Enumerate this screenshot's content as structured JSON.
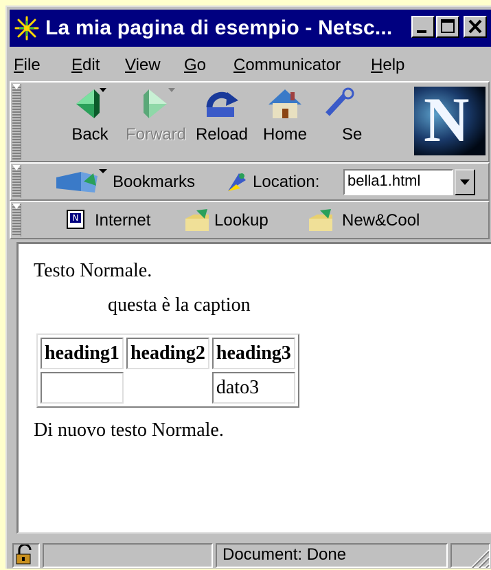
{
  "window": {
    "title": "La mia pagina di esempio - Netsc..."
  },
  "menu": [
    {
      "label_u": "F",
      "label_rest": "ile"
    },
    {
      "label_u": "E",
      "label_rest": "dit"
    },
    {
      "label_u": "V",
      "label_rest": "iew"
    },
    {
      "label_u": "G",
      "label_rest": "o"
    },
    {
      "label_u": "C",
      "label_rest": "ommunicator"
    },
    {
      "label_u": "H",
      "label_rest": "elp"
    }
  ],
  "nav_toolbar": {
    "back": "Back",
    "forward": "Forward",
    "reload": "Reload",
    "home": "Home",
    "search": "Sea"
  },
  "location_toolbar": {
    "bookmarks": "Bookmarks",
    "location_label": "Location:",
    "location_value": "bella1.html"
  },
  "personal_toolbar": {
    "items": [
      "Internet",
      "Lookup",
      "New&Cool"
    ]
  },
  "page": {
    "text1": "Testo Normale.",
    "caption": "questa è la caption",
    "headings": [
      "heading1",
      "heading2",
      "heading3"
    ],
    "row1_col3": "dato3",
    "text2": "Di nuovo testo Normale."
  },
  "status": {
    "text": "Document: Done"
  },
  "colors": {
    "title_bar": "#000080",
    "chrome": "#c0c0c0",
    "desktop": "#ffffcc"
  }
}
